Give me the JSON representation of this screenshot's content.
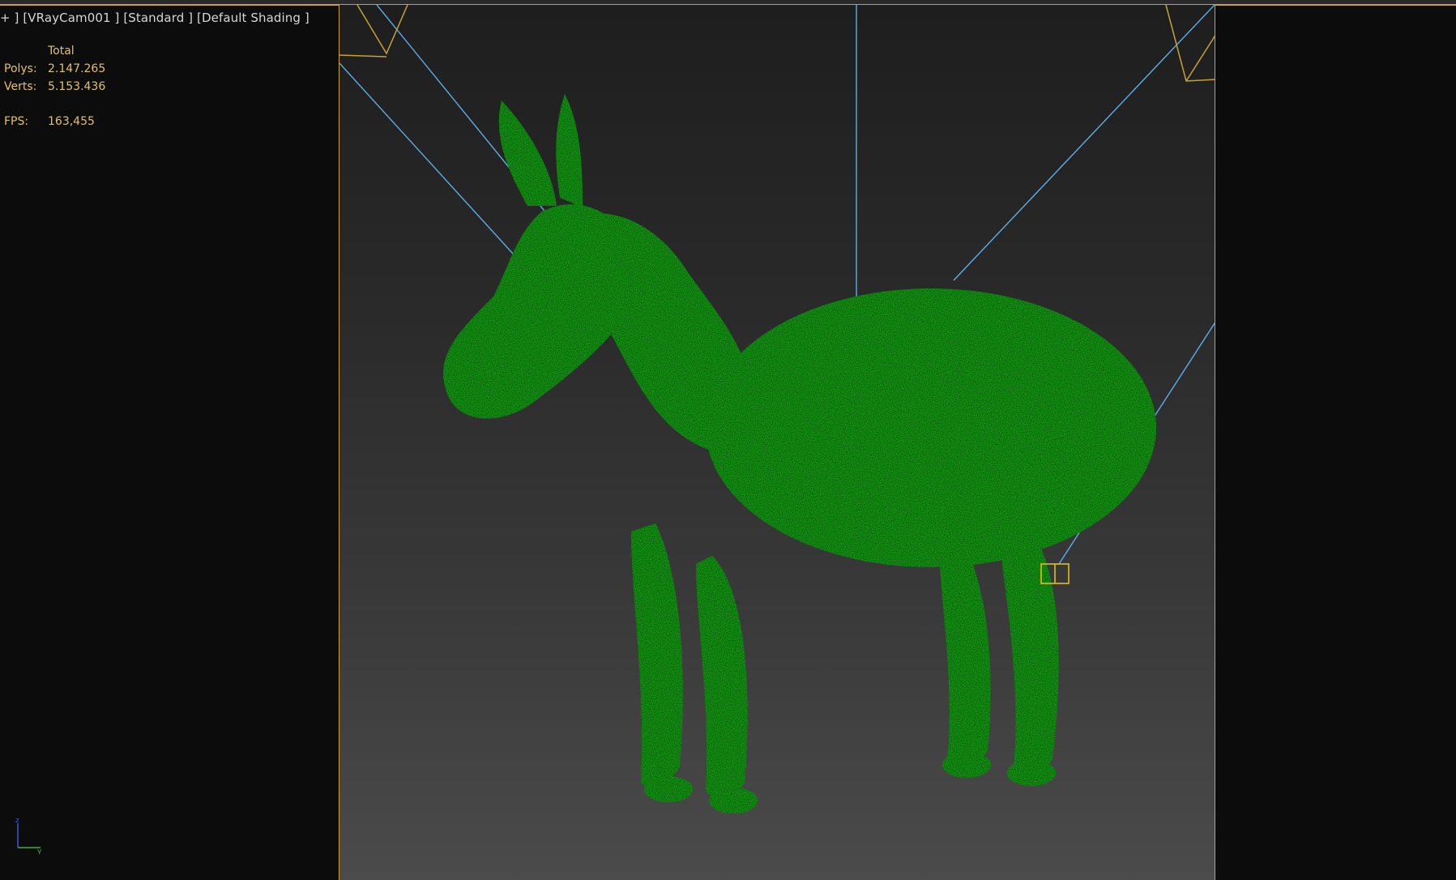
{
  "viewport": {
    "label": "+ ] [VRayCam001 ] [Standard ] [Default Shading ]",
    "stats": {
      "header": "Total",
      "polys_label": "Polys:",
      "polys_value": "2.147.265",
      "verts_label": "Verts:",
      "verts_value": "5.153.436",
      "fps_label": "FPS:",
      "fps_value": "163,455"
    },
    "axis_gizmo": {
      "z_label": "z",
      "y_label": "y"
    },
    "colors": {
      "frame": "#c8a32e",
      "camera_lines": "#5aaee8",
      "model": "#1fa21f",
      "stats_text": "#e4c25a"
    },
    "model_icon": "donkey-model"
  }
}
